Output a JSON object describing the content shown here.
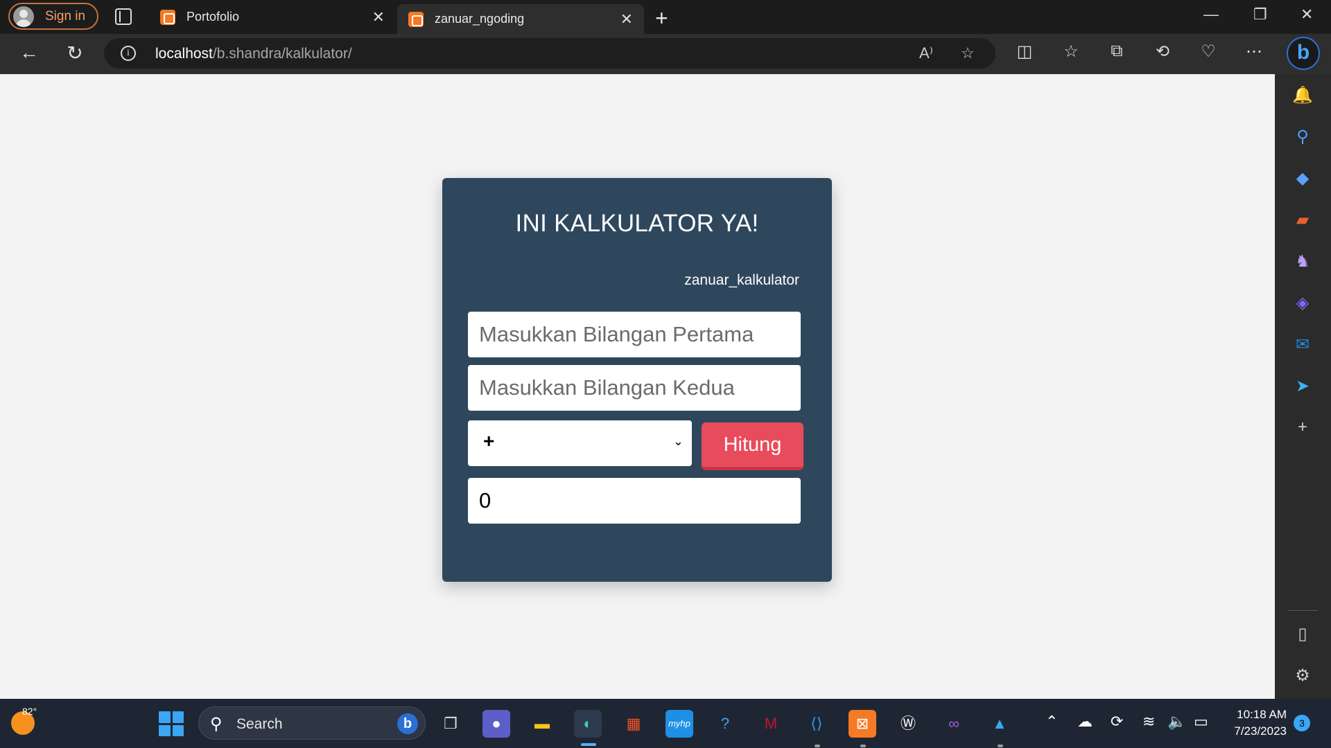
{
  "browser": {
    "signin_label": "Sign in",
    "tabs": [
      {
        "title": "Portofolio",
        "active": false
      },
      {
        "title": "zanuar_ngoding",
        "active": true
      }
    ],
    "address": {
      "host": "localhost",
      "path": "/b.shandra/kalkulator/"
    }
  },
  "calculator": {
    "title": "INI KALKULATOR YA!",
    "brand": "zanuar_kalkulator",
    "first_placeholder": "Masukkan Bilangan Pertama",
    "second_placeholder": "Masukkan Bilangan Kedua",
    "operator": "+",
    "compute_label": "Hitung",
    "result": "0",
    "colors": {
      "card": "#2f475c",
      "button": "#e84c5c",
      "page": "#f3f3f3"
    }
  },
  "taskbar": {
    "temperature": "82°",
    "search_label": "Search",
    "time": "10:18 AM",
    "date": "7/23/2023",
    "notifications": "3"
  }
}
